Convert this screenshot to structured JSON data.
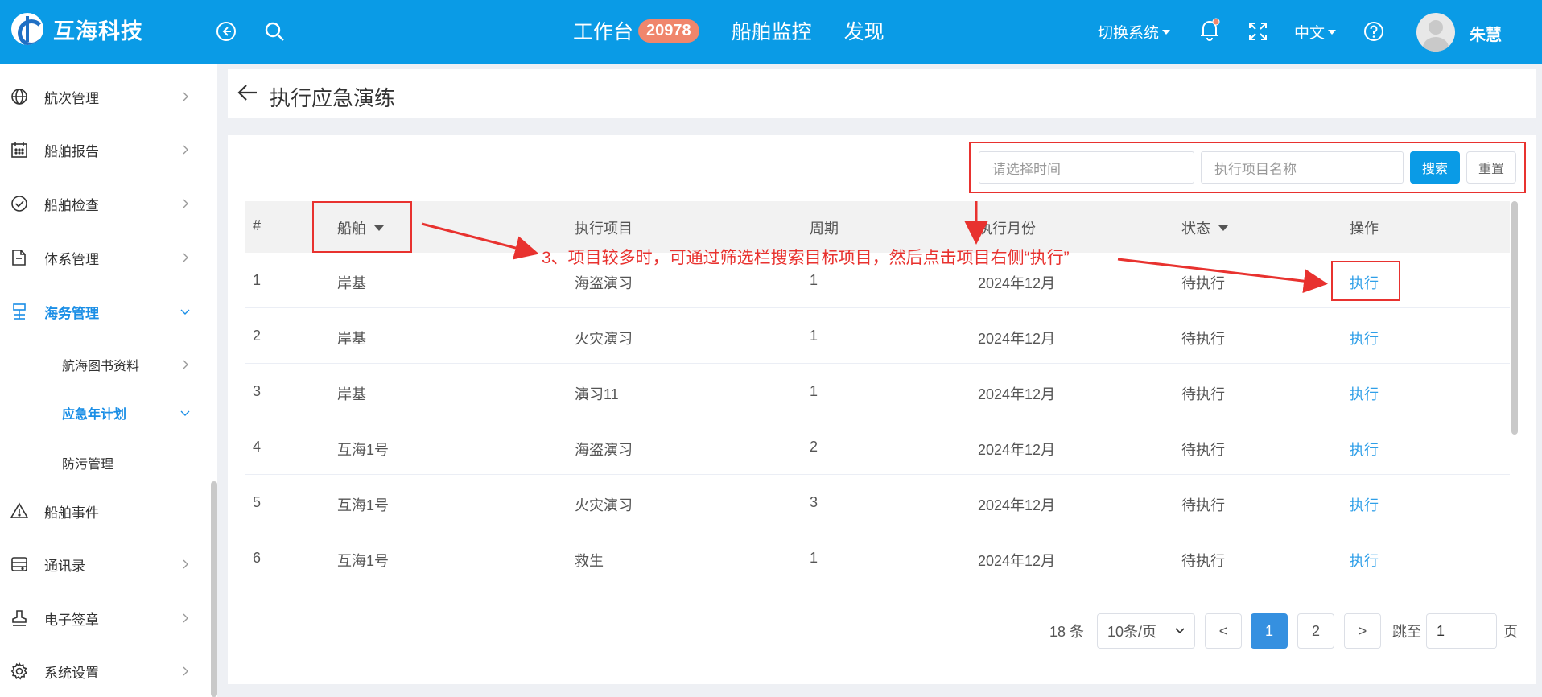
{
  "header": {
    "brand_name": "互海科技",
    "nav": [
      {
        "label": "工作台",
        "badge": "20978"
      },
      {
        "label": "船舶监控"
      },
      {
        "label": "发现"
      }
    ],
    "switch_system": "切换系统",
    "language": "中文",
    "user_name": "朱慧"
  },
  "sidebar": {
    "items": [
      {
        "label": "航次管理",
        "icon": "globe-icon"
      },
      {
        "label": "船舶报告",
        "icon": "calendar-icon"
      },
      {
        "label": "船舶检查",
        "icon": "check-circle-icon"
      },
      {
        "label": "体系管理",
        "icon": "document-icon"
      },
      {
        "label": "海务管理",
        "icon": "maritime-icon"
      },
      {
        "label": "航海图书资料"
      },
      {
        "label": "应急年计划"
      },
      {
        "label": "防污管理"
      },
      {
        "label": "船舶事件",
        "icon": "warning-icon"
      },
      {
        "label": "通讯录",
        "icon": "contacts-icon"
      },
      {
        "label": "电子签章",
        "icon": "stamp-icon"
      },
      {
        "label": "系统设置",
        "icon": "gear-icon"
      }
    ]
  },
  "page": {
    "title": "执行应急演练"
  },
  "filters": {
    "time_placeholder": "请选择时间",
    "name_placeholder": "执行项目名称",
    "search_label": "搜索",
    "reset_label": "重置"
  },
  "table": {
    "columns": [
      "#",
      "船舶",
      "执行项目",
      "周期",
      "执行月份",
      "状态",
      "操作"
    ],
    "rows": [
      {
        "no": "1",
        "ship": "岸基",
        "item": "海盗演习",
        "cycle": "1",
        "month": "2024年12月",
        "status": "待执行",
        "action": "执行"
      },
      {
        "no": "2",
        "ship": "岸基",
        "item": "火灾演习",
        "cycle": "1",
        "month": "2024年12月",
        "status": "待执行",
        "action": "执行"
      },
      {
        "no": "3",
        "ship": "岸基",
        "item": "演习11",
        "cycle": "1",
        "month": "2024年12月",
        "status": "待执行",
        "action": "执行"
      },
      {
        "no": "4",
        "ship": "互海1号",
        "item": "海盗演习",
        "cycle": "2",
        "month": "2024年12月",
        "status": "待执行",
        "action": "执行"
      },
      {
        "no": "5",
        "ship": "互海1号",
        "item": "火灾演习",
        "cycle": "3",
        "month": "2024年12月",
        "status": "待执行",
        "action": "执行"
      },
      {
        "no": "6",
        "ship": "互海1号",
        "item": "救生",
        "cycle": "1",
        "month": "2024年12月",
        "status": "待执行",
        "action": "执行"
      }
    ]
  },
  "annotation": {
    "text": "3、项目较多时，可通过筛选栏搜索目标项目，然后点击项目右侧“执行”",
    "color": "#e8322f"
  },
  "pagination": {
    "total": "18 条",
    "page_size": "10条/页",
    "prev": "<",
    "pages": [
      "1",
      "2"
    ],
    "current": "1",
    "next": ">",
    "jump_label": "跳至",
    "jump_value": "1",
    "page_suffix": "页"
  },
  "colors": {
    "header_bg": "#0a9be6",
    "accent": "#1a8ee6",
    "badge": "#f0866c",
    "link": "#2f9fe8",
    "highlight": "#e8322f"
  }
}
